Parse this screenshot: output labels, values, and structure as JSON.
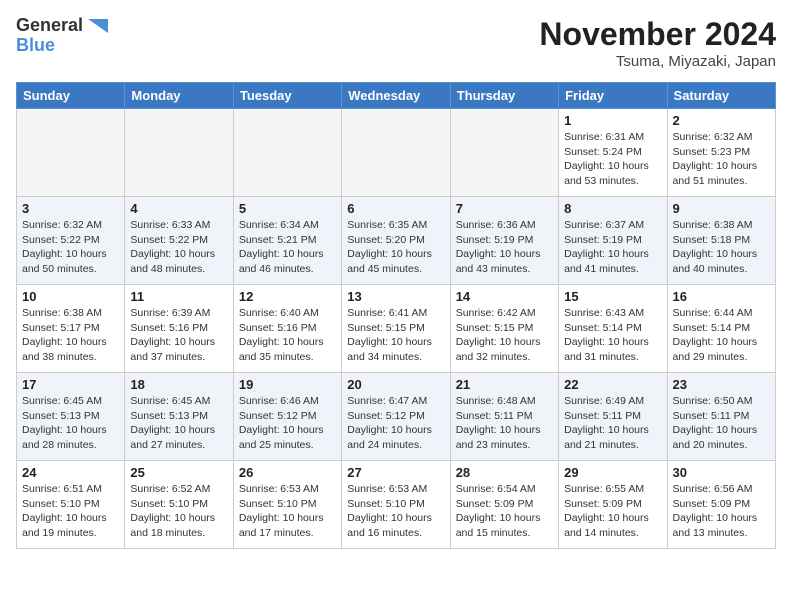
{
  "header": {
    "logo_line1": "General",
    "logo_line2": "Blue",
    "month": "November 2024",
    "location": "Tsuma, Miyazaki, Japan"
  },
  "weekdays": [
    "Sunday",
    "Monday",
    "Tuesday",
    "Wednesday",
    "Thursday",
    "Friday",
    "Saturday"
  ],
  "weeks": [
    [
      {
        "day": "",
        "info": ""
      },
      {
        "day": "",
        "info": ""
      },
      {
        "day": "",
        "info": ""
      },
      {
        "day": "",
        "info": ""
      },
      {
        "day": "",
        "info": ""
      },
      {
        "day": "1",
        "info": "Sunrise: 6:31 AM\nSunset: 5:24 PM\nDaylight: 10 hours and 53 minutes."
      },
      {
        "day": "2",
        "info": "Sunrise: 6:32 AM\nSunset: 5:23 PM\nDaylight: 10 hours and 51 minutes."
      }
    ],
    [
      {
        "day": "3",
        "info": "Sunrise: 6:32 AM\nSunset: 5:22 PM\nDaylight: 10 hours and 50 minutes."
      },
      {
        "day": "4",
        "info": "Sunrise: 6:33 AM\nSunset: 5:22 PM\nDaylight: 10 hours and 48 minutes."
      },
      {
        "day": "5",
        "info": "Sunrise: 6:34 AM\nSunset: 5:21 PM\nDaylight: 10 hours and 46 minutes."
      },
      {
        "day": "6",
        "info": "Sunrise: 6:35 AM\nSunset: 5:20 PM\nDaylight: 10 hours and 45 minutes."
      },
      {
        "day": "7",
        "info": "Sunrise: 6:36 AM\nSunset: 5:19 PM\nDaylight: 10 hours and 43 minutes."
      },
      {
        "day": "8",
        "info": "Sunrise: 6:37 AM\nSunset: 5:19 PM\nDaylight: 10 hours and 41 minutes."
      },
      {
        "day": "9",
        "info": "Sunrise: 6:38 AM\nSunset: 5:18 PM\nDaylight: 10 hours and 40 minutes."
      }
    ],
    [
      {
        "day": "10",
        "info": "Sunrise: 6:38 AM\nSunset: 5:17 PM\nDaylight: 10 hours and 38 minutes."
      },
      {
        "day": "11",
        "info": "Sunrise: 6:39 AM\nSunset: 5:16 PM\nDaylight: 10 hours and 37 minutes."
      },
      {
        "day": "12",
        "info": "Sunrise: 6:40 AM\nSunset: 5:16 PM\nDaylight: 10 hours and 35 minutes."
      },
      {
        "day": "13",
        "info": "Sunrise: 6:41 AM\nSunset: 5:15 PM\nDaylight: 10 hours and 34 minutes."
      },
      {
        "day": "14",
        "info": "Sunrise: 6:42 AM\nSunset: 5:15 PM\nDaylight: 10 hours and 32 minutes."
      },
      {
        "day": "15",
        "info": "Sunrise: 6:43 AM\nSunset: 5:14 PM\nDaylight: 10 hours and 31 minutes."
      },
      {
        "day": "16",
        "info": "Sunrise: 6:44 AM\nSunset: 5:14 PM\nDaylight: 10 hours and 29 minutes."
      }
    ],
    [
      {
        "day": "17",
        "info": "Sunrise: 6:45 AM\nSunset: 5:13 PM\nDaylight: 10 hours and 28 minutes."
      },
      {
        "day": "18",
        "info": "Sunrise: 6:45 AM\nSunset: 5:13 PM\nDaylight: 10 hours and 27 minutes."
      },
      {
        "day": "19",
        "info": "Sunrise: 6:46 AM\nSunset: 5:12 PM\nDaylight: 10 hours and 25 minutes."
      },
      {
        "day": "20",
        "info": "Sunrise: 6:47 AM\nSunset: 5:12 PM\nDaylight: 10 hours and 24 minutes."
      },
      {
        "day": "21",
        "info": "Sunrise: 6:48 AM\nSunset: 5:11 PM\nDaylight: 10 hours and 23 minutes."
      },
      {
        "day": "22",
        "info": "Sunrise: 6:49 AM\nSunset: 5:11 PM\nDaylight: 10 hours and 21 minutes."
      },
      {
        "day": "23",
        "info": "Sunrise: 6:50 AM\nSunset: 5:11 PM\nDaylight: 10 hours and 20 minutes."
      }
    ],
    [
      {
        "day": "24",
        "info": "Sunrise: 6:51 AM\nSunset: 5:10 PM\nDaylight: 10 hours and 19 minutes."
      },
      {
        "day": "25",
        "info": "Sunrise: 6:52 AM\nSunset: 5:10 PM\nDaylight: 10 hours and 18 minutes."
      },
      {
        "day": "26",
        "info": "Sunrise: 6:53 AM\nSunset: 5:10 PM\nDaylight: 10 hours and 17 minutes."
      },
      {
        "day": "27",
        "info": "Sunrise: 6:53 AM\nSunset: 5:10 PM\nDaylight: 10 hours and 16 minutes."
      },
      {
        "day": "28",
        "info": "Sunrise: 6:54 AM\nSunset: 5:09 PM\nDaylight: 10 hours and 15 minutes."
      },
      {
        "day": "29",
        "info": "Sunrise: 6:55 AM\nSunset: 5:09 PM\nDaylight: 10 hours and 14 minutes."
      },
      {
        "day": "30",
        "info": "Sunrise: 6:56 AM\nSunset: 5:09 PM\nDaylight: 10 hours and 13 minutes."
      }
    ]
  ]
}
